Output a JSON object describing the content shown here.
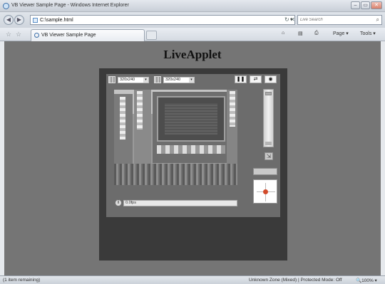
{
  "window": {
    "title": "VB Viewer Sample Page - Windows Internet Explorer",
    "minimize": "–",
    "maximize": "▭",
    "close": "✕"
  },
  "address": {
    "url": "C:\\sample.html",
    "dropdown": "▾",
    "refresh": "↻",
    "stop": "✕",
    "search_placeholder": "Live Search",
    "search_icon": "⌕"
  },
  "tab": {
    "label": "VB Viewer Sample Page"
  },
  "commands": {
    "home": "⌂",
    "feeds": "▤",
    "print": "⎙",
    "page": "Page ▾",
    "tools": "Tools ▾"
  },
  "page": {
    "title": "LiveApplet",
    "resolution_left": "320x240",
    "resolution_right": "320x240",
    "pause_button": "❚❚",
    "swap_button": "⇄",
    "audio_button": "◉",
    "snapshot_icon": "⇲",
    "info_icon": "i",
    "status_text": "0.0fps"
  },
  "status": {
    "left": "(1 item remaining)",
    "zone": "Unknown Zone (Mixed) | Protected Mode: Off",
    "zoom": "🔍100%  ▾"
  },
  "colors": {
    "background": "#757575",
    "applet": "#3a3a3a",
    "viewer": "#6c6c6c",
    "ptz_dot": "#d24a2a"
  }
}
